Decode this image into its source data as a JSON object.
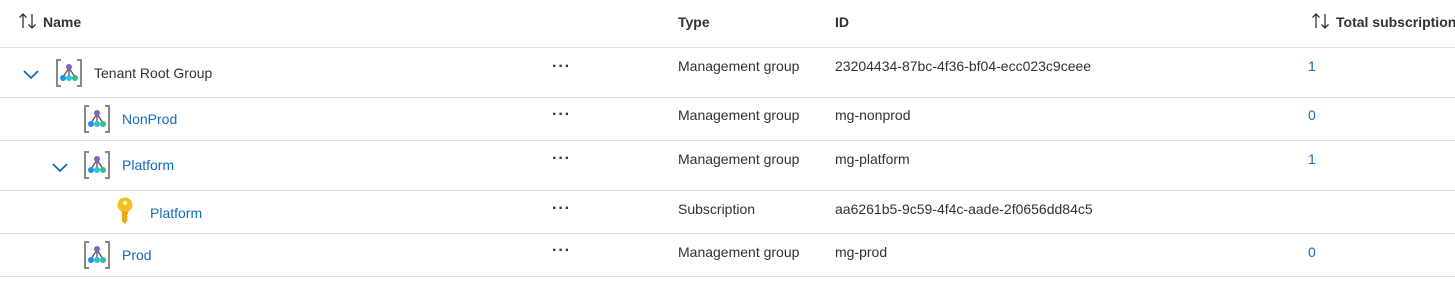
{
  "columns": {
    "name": "Name",
    "type": "Type",
    "id": "ID",
    "total": "Total subscriptions"
  },
  "icons": {
    "sort": "sort-arrows-icon",
    "management_group": "management-group-icon",
    "subscription": "key-icon",
    "expand": "chevron-down-icon",
    "more": "more-actions-icon"
  },
  "colors": {
    "link": "#0f6cbd",
    "text": "#323130",
    "key": "#f2c31f",
    "border": "#e1dfdd"
  },
  "more_label": "···",
  "rows": [
    {
      "name": "Tenant Root Group",
      "type": "Management group",
      "id": "23204434-87bc-4f36-bf04-ecc023c9ceee",
      "total": "1"
    },
    {
      "name": "NonProd",
      "type": "Management group",
      "id": "mg-nonprod",
      "total": "0"
    },
    {
      "name": "Platform",
      "type": "Management group",
      "id": "mg-platform",
      "total": "1"
    },
    {
      "name": "Platform",
      "type": "Subscription",
      "id": "aa6261b5-9c59-4f4c-aade-2f0656dd84c5",
      "total": ""
    },
    {
      "name": "Prod",
      "type": "Management group",
      "id": "mg-prod",
      "total": "0"
    }
  ]
}
